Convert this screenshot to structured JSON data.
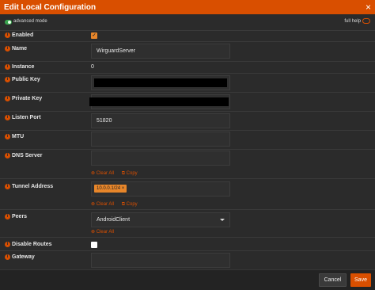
{
  "window": {
    "title": "Edit Local Configuration",
    "close_glyph": "×"
  },
  "topbar": {
    "advanced_mode_label": "advanced mode",
    "full_help_label": "full help"
  },
  "fields": {
    "enabled": {
      "label": "Enabled",
      "checked": true
    },
    "name": {
      "label": "Name",
      "value": "WirguardServer"
    },
    "instance": {
      "label": "Instance",
      "value": "0"
    },
    "public_key": {
      "label": "Public Key"
    },
    "private_key": {
      "label": "Private Key"
    },
    "listen_port": {
      "label": "Listen Port",
      "value": "51820"
    },
    "mtu": {
      "label": "MTU",
      "value": ""
    },
    "dns_server": {
      "label": "DNS Server",
      "value": "",
      "clear_all": "Clear All",
      "copy": "Copy"
    },
    "tunnel_address": {
      "label": "Tunnel Address",
      "tag": "10.0.0.1/24 ×",
      "clear_all": "Clear All",
      "copy": "Copy"
    },
    "peers": {
      "label": "Peers",
      "selected": "AndroidClient",
      "clear_all": "Clear All"
    },
    "disable_routes": {
      "label": "Disable Routes",
      "checked": false
    },
    "gateway": {
      "label": "Gateway",
      "value": ""
    }
  },
  "footer": {
    "cancel_label": "Cancel",
    "save_label": "Save"
  },
  "colors": {
    "accent": "#d94f00",
    "background": "#2b2b2b",
    "toggle_on": "#3aa54f"
  },
  "icons": {
    "info": "info-icon",
    "clear": "clear-icon",
    "copy": "copy-icon"
  }
}
